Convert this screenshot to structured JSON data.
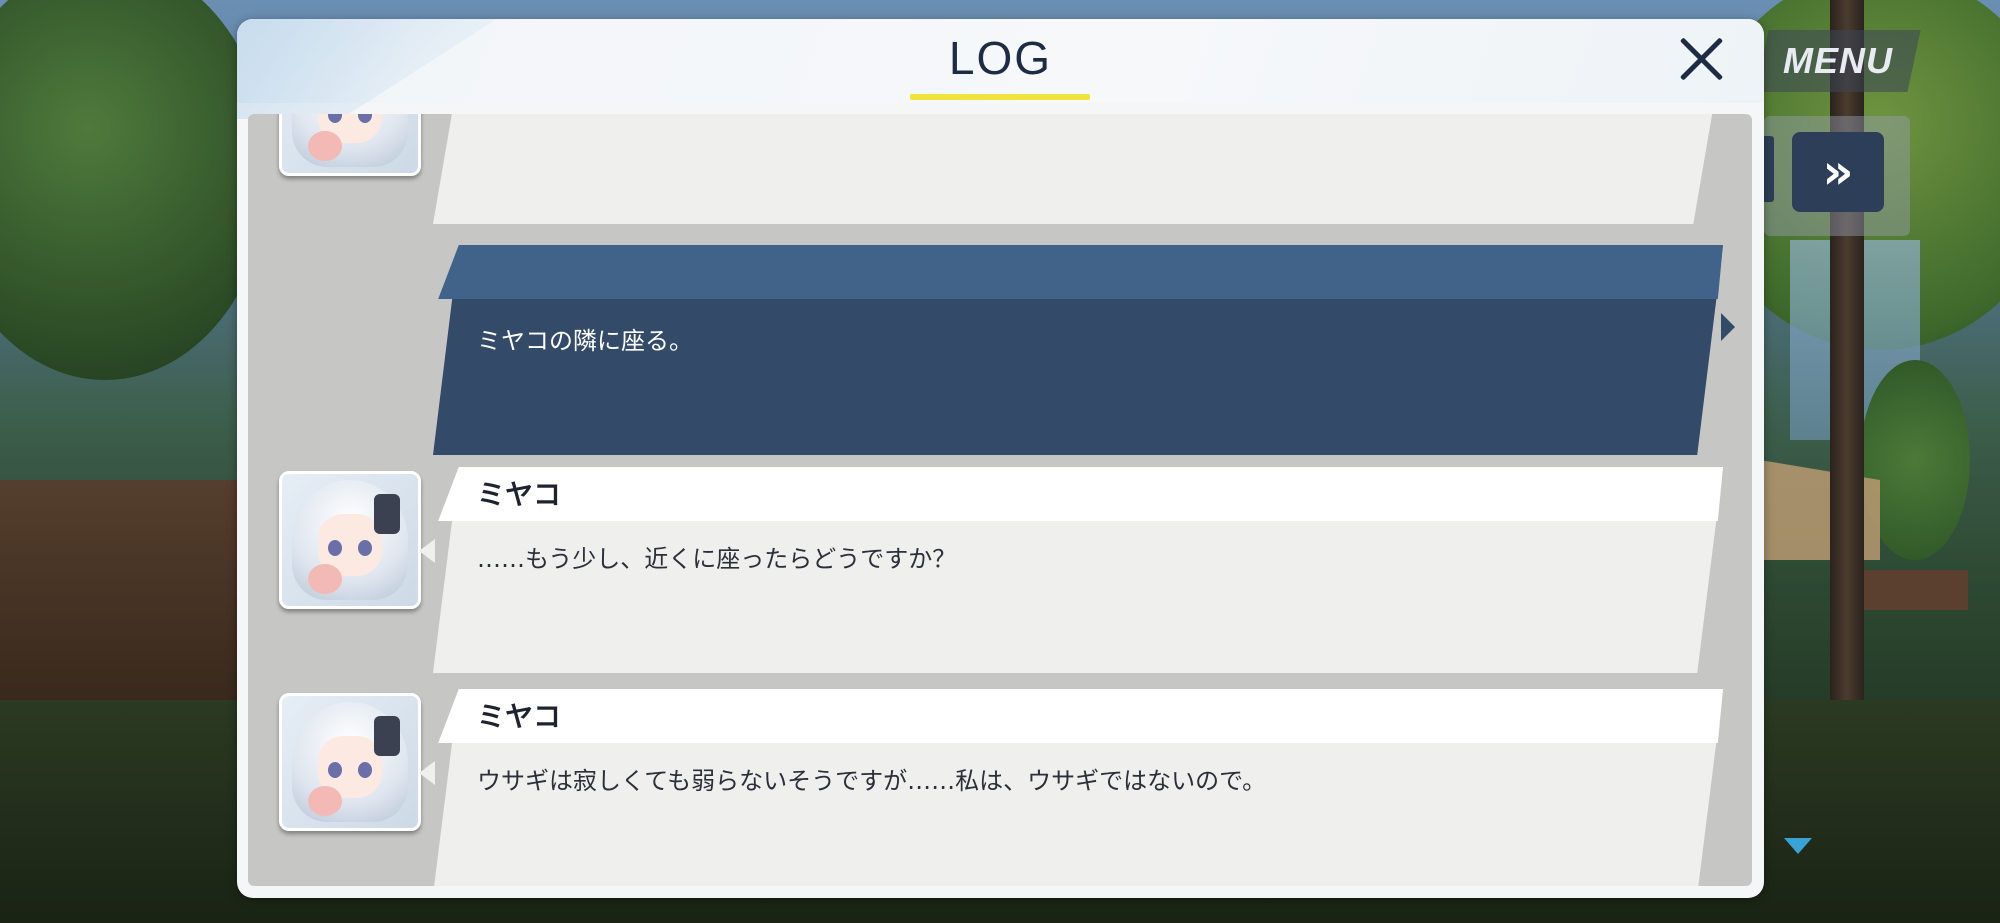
{
  "hud": {
    "menu_label": "MENU",
    "fast_forward_icon": "»"
  },
  "log_panel": {
    "title": "LOG",
    "accent_color": "#f2e23c",
    "entries": [
      {
        "speaker": "",
        "text": ""
      },
      {
        "speaker": "",
        "text": "ミヤコの隣に座る。",
        "type": "player"
      },
      {
        "speaker": "ミヤコ",
        "text": "……もう少し、近くに座ったらどうですか？"
      },
      {
        "speaker": "ミヤコ",
        "text": "ウサギは寂しくても弱らないそうですが……私は、ウサギではないので。"
      }
    ]
  },
  "colors": {
    "player_bubble": "#334a69",
    "player_namebar": "#426389",
    "npc_bubble": "#efefed"
  }
}
